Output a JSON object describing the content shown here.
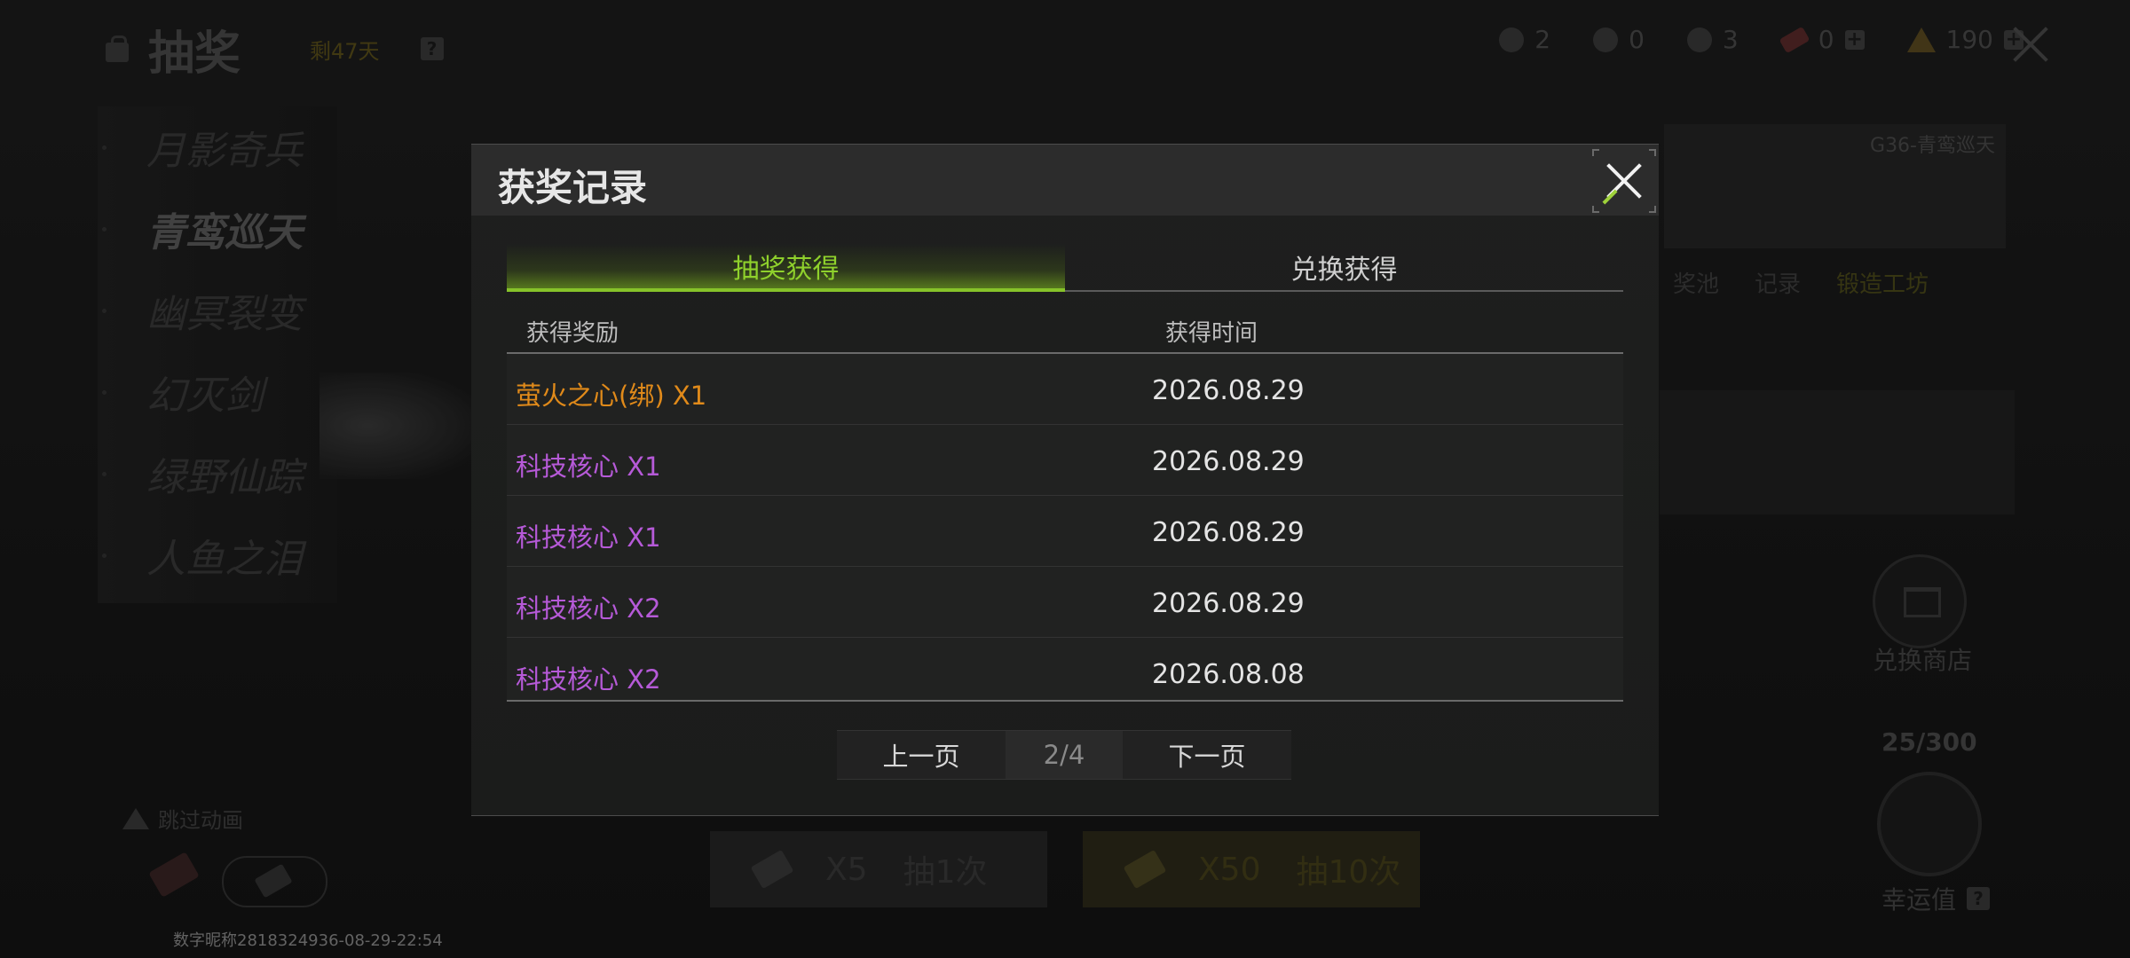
{
  "background": {
    "page_title": "抽奖",
    "days_left": "剩47天",
    "help_glyph": "?",
    "currencies": [
      {
        "icon": "medal-icon",
        "value": "2"
      },
      {
        "icon": "helmet-icon",
        "value": "0"
      },
      {
        "icon": "key-icon",
        "value": "3"
      },
      {
        "icon": "ticket-icon",
        "value": "0"
      },
      {
        "icon": "gold-icon",
        "value": "190"
      }
    ],
    "plus_glyph": "+",
    "side_items": [
      "月影奇兵",
      "青鸾巡天",
      "幽冥裂变",
      "幻灭剑",
      "绿野仙踪",
      "人鱼之泪"
    ],
    "preview_title": "G36-青鸾巡天",
    "preview_tabs": [
      "奖池",
      "记录",
      "锻造工坊"
    ],
    "shop_label": "兑换商店",
    "luck_count": "25/300",
    "luck_label": "幸运值",
    "skip_label": "跳过动画",
    "draw_one": {
      "cost": "X5",
      "label": "抽1次"
    },
    "draw_ten": {
      "cost": "X50",
      "label": "抽10次"
    },
    "watermark": "数字昵称2818324936-08-29-22:54"
  },
  "modal": {
    "title": "获奖记录",
    "tabs": [
      {
        "label": "抽奖获得",
        "active": true
      },
      {
        "label": "兑换获得",
        "active": false
      }
    ],
    "columns": {
      "reward": "获得奖励",
      "time": "获得时间"
    },
    "rows": [
      {
        "reward": "萤火之心(绑) X1",
        "time": "2026.08.29",
        "quality": "orange"
      },
      {
        "reward": "科技核心 X1",
        "time": "2026.08.29",
        "quality": "purple"
      },
      {
        "reward": "科技核心 X1",
        "time": "2026.08.29",
        "quality": "purple"
      },
      {
        "reward": "科技核心 X2",
        "time": "2026.08.29",
        "quality": "purple"
      },
      {
        "reward": "科技核心 X2",
        "time": "2026.08.08",
        "quality": "purple"
      }
    ],
    "pager": {
      "prev": "上一页",
      "page": "2/4",
      "next": "下一页"
    }
  },
  "colors": {
    "accent_green": "#8fd12c",
    "quality_orange": "#e08a1a",
    "quality_purple": "#b65ad8"
  }
}
